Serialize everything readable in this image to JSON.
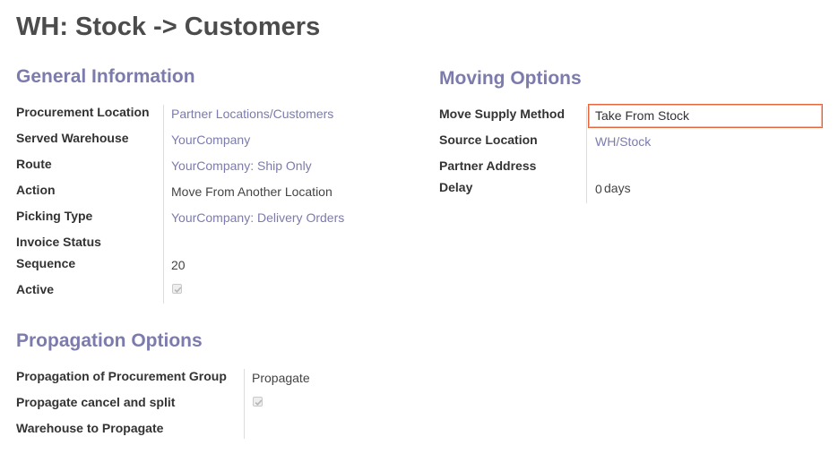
{
  "page": {
    "title": "WH: Stock -> Customers"
  },
  "general": {
    "heading": "General Information",
    "fields": [
      {
        "label": "Procurement Location",
        "value": "Partner Locations/Customers"
      },
      {
        "label": "Served Warehouse",
        "value": "YourCompany"
      },
      {
        "label": "Route",
        "value": "YourCompany: Ship Only"
      },
      {
        "label": "Action",
        "value": "Move From Another Location"
      },
      {
        "label": "Picking Type",
        "value": "YourCompany: Delivery Orders"
      },
      {
        "label": "Invoice Status",
        "value": ""
      },
      {
        "label": "Sequence",
        "value": "20"
      },
      {
        "label": "Active",
        "value": true
      }
    ]
  },
  "moving": {
    "heading": "Moving Options",
    "fields": [
      {
        "label": "Move Supply Method",
        "value": "Take From Stock"
      },
      {
        "label": "Source Location",
        "value": "WH/Stock"
      },
      {
        "label": "Partner Address",
        "value": ""
      },
      {
        "label": "Delay",
        "value": "0",
        "unit": "days"
      }
    ]
  },
  "propagation": {
    "heading": "Propagation Options",
    "fields": [
      {
        "label": "Propagation of Procurement Group",
        "value": "Propagate"
      },
      {
        "label": "Propagate cancel and split",
        "value": true
      },
      {
        "label": "Warehouse to Propagate",
        "value": ""
      }
    ]
  },
  "colors": {
    "accent": "#7c7bad",
    "focus_border": "#e3673b"
  }
}
